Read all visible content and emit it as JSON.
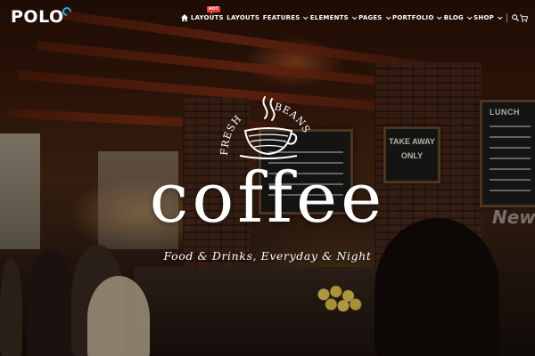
{
  "header": {
    "logo": "POLO",
    "nav": [
      {
        "label": "LAYOUTS",
        "badge": "HOT",
        "dropdown": false
      },
      {
        "label": "LAYOUTS",
        "dropdown": false
      },
      {
        "label": "FEATURES",
        "dropdown": true
      },
      {
        "label": "ELEMENTS",
        "dropdown": true
      },
      {
        "label": "PAGES",
        "dropdown": true
      },
      {
        "label": "PORTFOLIO",
        "dropdown": true
      },
      {
        "label": "BLOG",
        "dropdown": true
      },
      {
        "label": "SHOP",
        "dropdown": true
      }
    ],
    "icons": {
      "home": "home-icon",
      "search": "search-icon",
      "cart": "cart-icon"
    }
  },
  "hero": {
    "badge_top_left": "FRESH",
    "badge_top_right": "BEANS",
    "title": "coffee",
    "subtitle": "Food & Drinks, Everyday & Night"
  },
  "scene": {
    "board_lunch": "LUNCH",
    "board_takeaway": "TAKE AWAY",
    "board_only": "ONLY",
    "neon": "New"
  },
  "colors": {
    "accent": "#2ab0e4",
    "badge": "#e8403a",
    "text": "#ffffff"
  }
}
